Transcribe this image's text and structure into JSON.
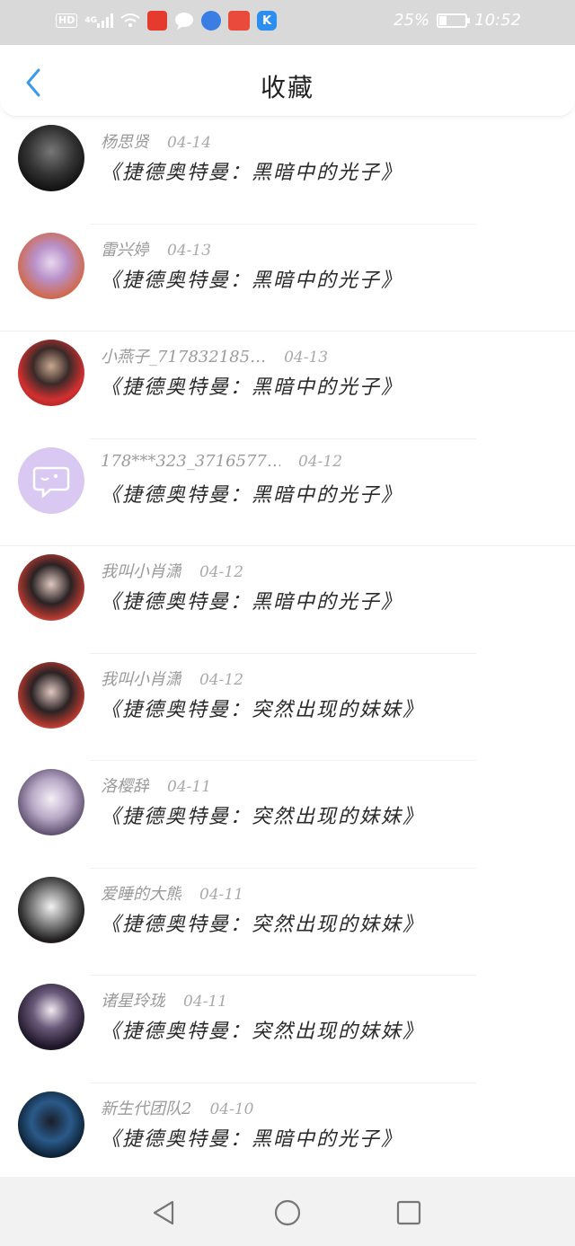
{
  "status_bar": {
    "hd_label": "HD",
    "network_label": "4G",
    "battery_text": "25%",
    "battery_level": 0.25,
    "time": "10:52",
    "app_icons": [
      "ting-app-icon",
      "chat-bubble-icon",
      "music-app-icon",
      "red-app-icon",
      "kugou-app-icon"
    ]
  },
  "header": {
    "title": "收藏",
    "back_icon": "chevron-left-icon"
  },
  "colors": {
    "accent": "#3a9ae8",
    "status_bar_bg": "#d9d9d9",
    "nav_bar_bg": "#f2f2f2"
  },
  "favorites": [
    {
      "user": "杨思贤",
      "date": "04-14",
      "title": "《捷德奥特曼：黑暗中的光子》"
    },
    {
      "user": "雷兴婷",
      "date": "04-13",
      "title": "《捷德奥特曼：黑暗中的光子》"
    },
    {
      "user": "小燕子_717832185…",
      "date": "04-13",
      "title": "《捷德奥特曼：黑暗中的光子》"
    },
    {
      "user": "178***323_3716577…",
      "date": "04-12",
      "title": "《捷德奥特曼：黑暗中的光子》"
    },
    {
      "user": "我叫小肖潇",
      "date": "04-12",
      "title": "《捷德奥特曼：黑暗中的光子》"
    },
    {
      "user": "我叫小肖潇",
      "date": "04-12",
      "title": "《捷德奥特曼：突然出现的妹妹》"
    },
    {
      "user": "洛樱辞",
      "date": "04-11",
      "title": "《捷德奥特曼：突然出现的妹妹》"
    },
    {
      "user": "爱睡的大熊",
      "date": "04-11",
      "title": "《捷德奥特曼：突然出现的妹妹》"
    },
    {
      "user": "诸星玲珑",
      "date": "04-11",
      "title": "《捷德奥特曼：突然出现的妹妹》"
    },
    {
      "user": "新生代团队2",
      "date": "04-10",
      "title": "《捷德奥特曼：黑暗中的光子》"
    }
  ],
  "nav_bar": {
    "back_icon": "triangle-back-icon",
    "home_icon": "circle-home-icon",
    "recents_icon": "square-recents-icon"
  }
}
